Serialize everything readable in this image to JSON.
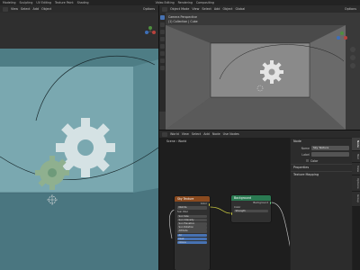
{
  "topbar": {
    "left_menu": [
      "Modeling",
      "Sculpting",
      "UV Editing",
      "Texture Paint",
      "Shading"
    ],
    "right_menu": [
      "Video Editing",
      "Rendering",
      "Compositing"
    ],
    "right_status": "Options"
  },
  "left_viewport": {
    "header_items": [
      "View",
      "Select",
      "Add",
      "Object"
    ],
    "options_label": "Options"
  },
  "right_viewport": {
    "header_items": [
      "Object Mode",
      "View",
      "Select",
      "Add",
      "Object",
      "Global"
    ],
    "camera_label": "Camera Perspective",
    "object_label": "(1) Collection | Cube",
    "options_label": "Options"
  },
  "node_editor": {
    "header_items": [
      "World",
      "View",
      "Select",
      "Add",
      "Node",
      "Use Nodes"
    ],
    "breadcrumb": [
      "Scene",
      "World"
    ],
    "image_texture_node": {
      "title": "Sky Texture",
      "output_label": "Color",
      "type_label": "Nishita",
      "sun_disc_label": "Sun Disc",
      "fields": [
        "Sun Size",
        "Sun Intensity",
        "Sun Elevation",
        "Sun Rotation",
        "Altitude",
        "Air",
        "Dust",
        "Ozone"
      ]
    },
    "background_node": {
      "title": "Background",
      "output_label": "Background",
      "inputs": [
        "Color",
        "Strength"
      ]
    }
  },
  "properties_panel": {
    "tabs": [
      "Node",
      "Tool",
      "View",
      "Options",
      "Group"
    ],
    "node_section": "Node",
    "name_label": "Name",
    "name_value": "Sky Texture",
    "label_label": "Label",
    "color_label": "Color",
    "properties_section": "Properties",
    "texture_mapping_section": "Texture Mapping"
  },
  "colors": {
    "viewport_left_bg": "#5e8a92",
    "gear_color": "#d8e4e6",
    "gear_green": "#8fb08f",
    "accent_blue": "#4772b3",
    "node_texture_header": "#8a4a1f",
    "node_shader_header": "#2a7a52"
  }
}
